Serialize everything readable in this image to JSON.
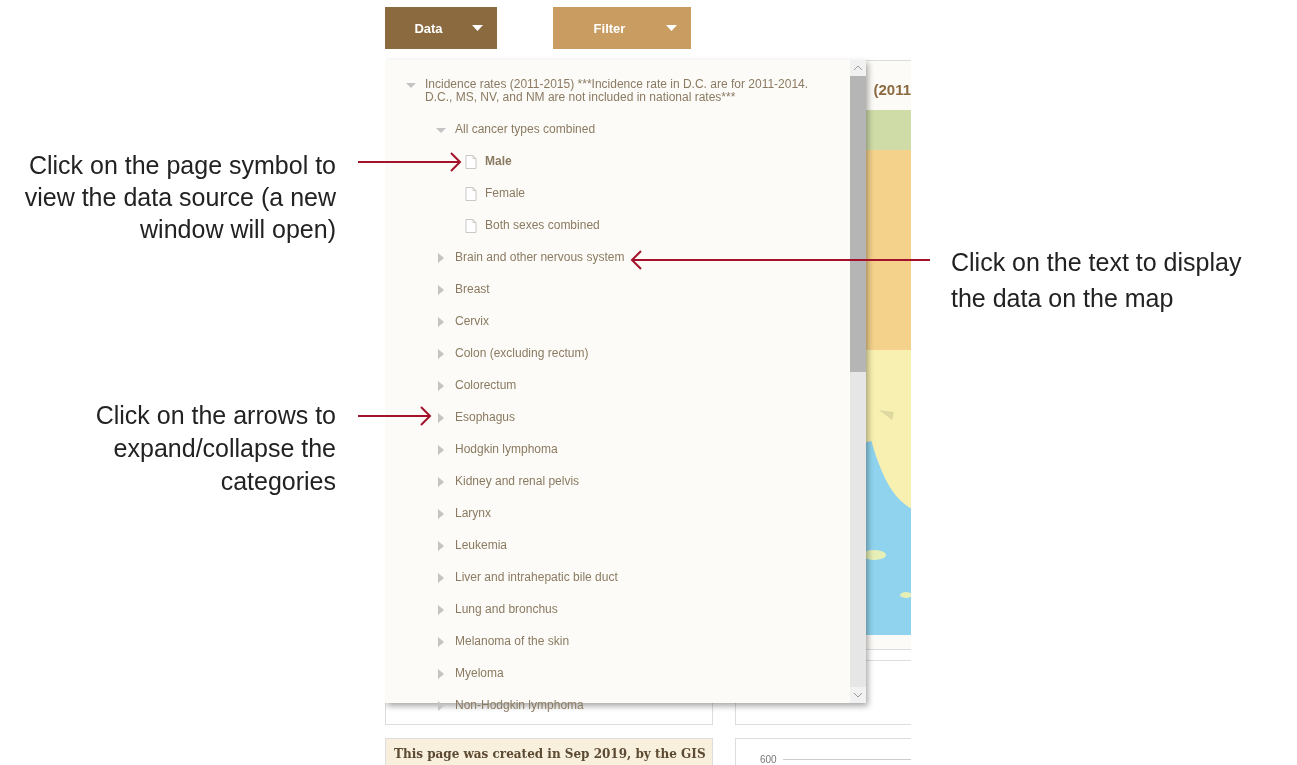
{
  "toolbar": [
    {
      "label": "Data",
      "selected": true
    },
    {
      "label": "Filter",
      "selected": false
    }
  ],
  "tree": {
    "label": "Incidence rates (2011-2015) ***Incidence rate in D.C. are for 2011-2014. D.C., MS, NV, and NM are not included in national rates***",
    "expanded": true,
    "children": [
      {
        "label": "All cancer types combined",
        "kind": "group",
        "expanded": true,
        "children": [
          {
            "label": "Male",
            "kind": "file",
            "selected": true
          },
          {
            "label": "Female",
            "kind": "file",
            "selected": false
          },
          {
            "label": "Both sexes combined",
            "kind": "file",
            "selected": false
          }
        ]
      },
      {
        "label": "Brain and other nervous system",
        "kind": "group",
        "expanded": false
      },
      {
        "label": "Breast",
        "kind": "group",
        "expanded": false
      },
      {
        "label": "Cervix",
        "kind": "group",
        "expanded": false
      },
      {
        "label": "Colon (excluding rectum)",
        "kind": "group",
        "expanded": false
      },
      {
        "label": "Colorectum",
        "kind": "group",
        "expanded": false
      },
      {
        "label": "Esophagus",
        "kind": "group",
        "expanded": false
      },
      {
        "label": "Hodgkin lymphoma",
        "kind": "group",
        "expanded": false
      },
      {
        "label": "Kidney and renal pelvis",
        "kind": "group",
        "expanded": false
      },
      {
        "label": "Larynx",
        "kind": "group",
        "expanded": false
      },
      {
        "label": "Leukemia",
        "kind": "group",
        "expanded": false
      },
      {
        "label": "Liver and intrahepatic bile duct",
        "kind": "group",
        "expanded": false
      },
      {
        "label": "Lung and bronchus",
        "kind": "group",
        "expanded": false
      },
      {
        "label": "Melanoma of the skin",
        "kind": "group",
        "expanded": false
      },
      {
        "label": "Myeloma",
        "kind": "group",
        "expanded": false
      },
      {
        "label": "Non-Hodgkin lymphoma",
        "kind": "group",
        "expanded": false
      }
    ]
  },
  "map_card": {
    "title": "(2011"
  },
  "footer_note": "This page was created in Sep 2019, by the GIS",
  "chart_tick": "600",
  "annotations": [
    {
      "text": "Click on the page symbol to view the data source (a new window will open)"
    },
    {
      "text": "Click on the arrows to expand/collapse the categories"
    },
    {
      "text": "Click on the text to display the data on the map"
    }
  ]
}
